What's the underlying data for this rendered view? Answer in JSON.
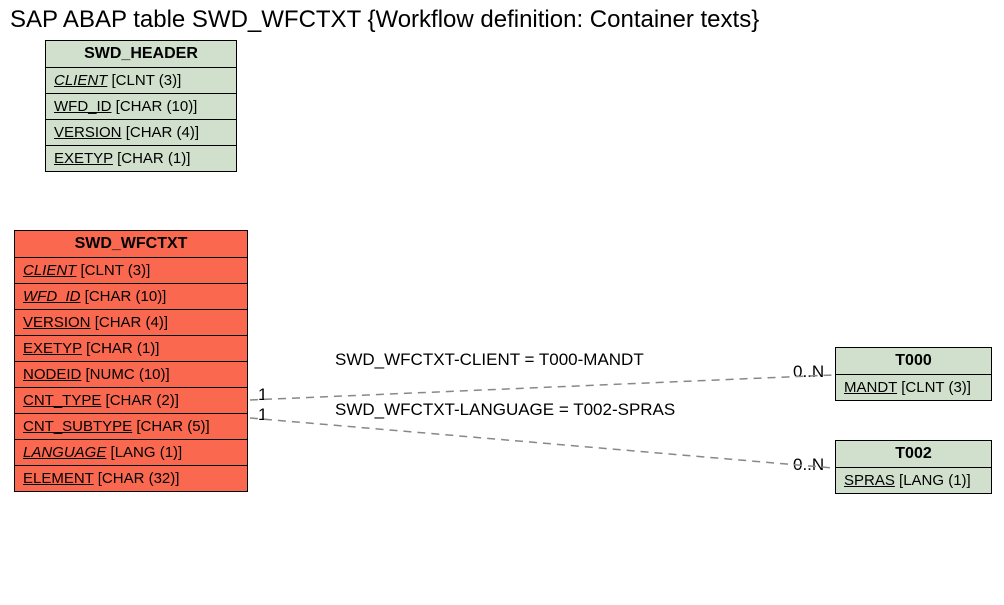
{
  "title": "SAP ABAP table SWD_WFCTXT {Workflow definition: Container texts}",
  "entities": {
    "swd_header": {
      "name": "SWD_HEADER",
      "fields": [
        {
          "name": "CLIENT",
          "type": "[CLNT (3)]",
          "italic": true
        },
        {
          "name": "WFD_ID",
          "type": "[CHAR (10)]",
          "italic": false
        },
        {
          "name": "VERSION",
          "type": "[CHAR (4)]",
          "italic": false
        },
        {
          "name": "EXETYP",
          "type": "[CHAR (1)]",
          "italic": false
        }
      ]
    },
    "swd_wfctxt": {
      "name": "SWD_WFCTXT",
      "fields": [
        {
          "name": "CLIENT",
          "type": "[CLNT (3)]",
          "italic": true
        },
        {
          "name": "WFD_ID",
          "type": "[CHAR (10)]",
          "italic": true
        },
        {
          "name": "VERSION",
          "type": "[CHAR (4)]",
          "italic": false
        },
        {
          "name": "EXETYP",
          "type": "[CHAR (1)]",
          "italic": false
        },
        {
          "name": "NODEID",
          "type": "[NUMC (10)]",
          "italic": false
        },
        {
          "name": "CNT_TYPE",
          "type": "[CHAR (2)]",
          "italic": false
        },
        {
          "name": "CNT_SUBTYPE",
          "type": "[CHAR (5)]",
          "italic": false
        },
        {
          "name": "LANGUAGE",
          "type": "[LANG (1)]",
          "italic": true
        },
        {
          "name": "ELEMENT",
          "type": "[CHAR (32)]",
          "italic": false
        }
      ]
    },
    "t000": {
      "name": "T000",
      "fields": [
        {
          "name": "MANDT",
          "type": "[CLNT (3)]",
          "italic": false
        }
      ]
    },
    "t002": {
      "name": "T002",
      "fields": [
        {
          "name": "SPRAS",
          "type": "[LANG (1)]",
          "italic": false
        }
      ]
    }
  },
  "relations": {
    "r1": {
      "label": "SWD_WFCTXT-CLIENT = T000-MANDT",
      "left_card": "1",
      "right_card": "0..N"
    },
    "r2": {
      "label": "SWD_WFCTXT-LANGUAGE = T002-SPRAS",
      "left_card": "1",
      "right_card": "0..N"
    }
  }
}
